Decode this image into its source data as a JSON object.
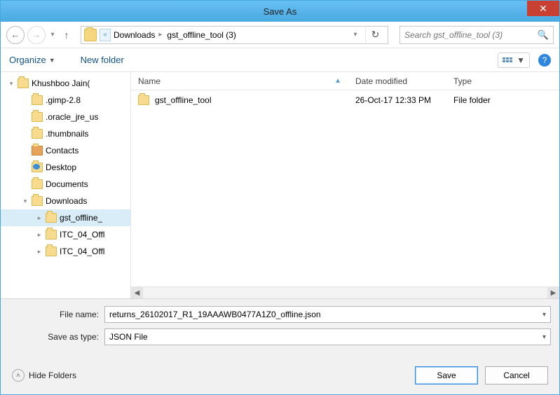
{
  "window": {
    "title": "Save As"
  },
  "nav": {
    "crumbs": [
      {
        "label": "Downloads"
      },
      {
        "label": "gst_offline_tool (3)"
      }
    ],
    "search_placeholder": "Search gst_offline_tool (3)"
  },
  "toolbar": {
    "organize": "Organize",
    "newfolder": "New folder"
  },
  "tree": {
    "items": [
      {
        "label": "Khushboo Jain(",
        "indent": 0,
        "icon": "user",
        "twisty": "▾"
      },
      {
        "label": ".gimp-2.8",
        "indent": 1,
        "icon": "folder",
        "twisty": ""
      },
      {
        "label": ".oracle_jre_us",
        "indent": 1,
        "icon": "folder",
        "twisty": ""
      },
      {
        "label": ".thumbnails",
        "indent": 1,
        "icon": "folder",
        "twisty": ""
      },
      {
        "label": "Contacts",
        "indent": 1,
        "icon": "contacts",
        "twisty": ""
      },
      {
        "label": "Desktop",
        "indent": 1,
        "icon": "desktop",
        "twisty": ""
      },
      {
        "label": "Documents",
        "indent": 1,
        "icon": "docs",
        "twisty": ""
      },
      {
        "label": "Downloads",
        "indent": 1,
        "icon": "folder",
        "twisty": "▾"
      },
      {
        "label": "gst_offline_",
        "indent": 2,
        "icon": "folder",
        "twisty": "▸",
        "selected": true
      },
      {
        "label": "ITC_04_Offl",
        "indent": 2,
        "icon": "folder",
        "twisty": "▸"
      },
      {
        "label": "ITC_04_Offl",
        "indent": 2,
        "icon": "folder",
        "twisty": "▸"
      }
    ]
  },
  "columns": {
    "name": "Name",
    "date": "Date modified",
    "type": "Type"
  },
  "files": [
    {
      "name": "gst_offline_tool",
      "date": "26-Oct-17 12:33 PM",
      "type": "File folder"
    }
  ],
  "form": {
    "filename_label": "File name:",
    "filename_value": "returns_26102017_R1_19AAAWB0477A1Z0_offline.json",
    "savetype_label": "Save as type:",
    "savetype_value": "JSON File"
  },
  "footer": {
    "hide": "Hide Folders",
    "save": "Save",
    "cancel": "Cancel"
  }
}
